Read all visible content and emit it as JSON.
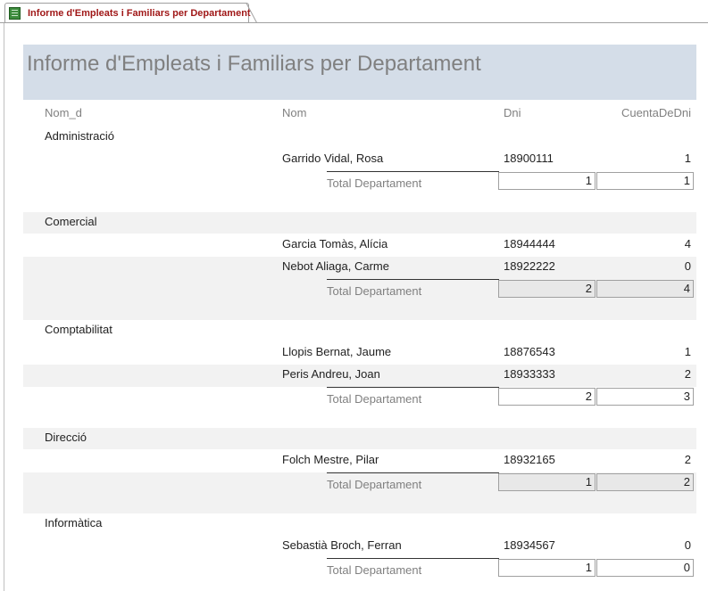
{
  "tab": {
    "label": "Informe d'Empleats i Familiars per Departament"
  },
  "report": {
    "title": "Informe d'Empleats i Familiars per Departament",
    "headers": {
      "dept": "Nom_d",
      "nom": "Nom",
      "dni": "Dni",
      "count": "CuentaDeDni"
    },
    "total_label": "Total Departament",
    "groups": [
      {
        "name": "Administració",
        "rows": [
          {
            "nom": "Garrido Vidal, Rosa",
            "dni": "18900111",
            "count": "1"
          }
        ],
        "total_employees": "1",
        "total_count": "1"
      },
      {
        "name": "Comercial",
        "rows": [
          {
            "nom": "Garcia Tomàs, Alícia",
            "dni": "18944444",
            "count": "4"
          },
          {
            "nom": "Nebot Aliaga, Carme",
            "dni": "18922222",
            "count": "0"
          }
        ],
        "total_employees": "2",
        "total_count": "4"
      },
      {
        "name": "Comptabilitat",
        "rows": [
          {
            "nom": "Llopis Bernat, Jaume",
            "dni": "18876543",
            "count": "1"
          },
          {
            "nom": "Peris Andreu, Joan",
            "dni": "18933333",
            "count": "2"
          }
        ],
        "total_employees": "2",
        "total_count": "3"
      },
      {
        "name": "Direcció",
        "rows": [
          {
            "nom": "Folch Mestre, Pilar",
            "dni": "18932165",
            "count": "2"
          }
        ],
        "total_employees": "1",
        "total_count": "2"
      },
      {
        "name": "Informàtica",
        "rows": [
          {
            "nom": "Sebastià Broch, Ferran",
            "dni": "18934567",
            "count": "0"
          }
        ],
        "total_employees": "1",
        "total_count": "0"
      }
    ]
  }
}
